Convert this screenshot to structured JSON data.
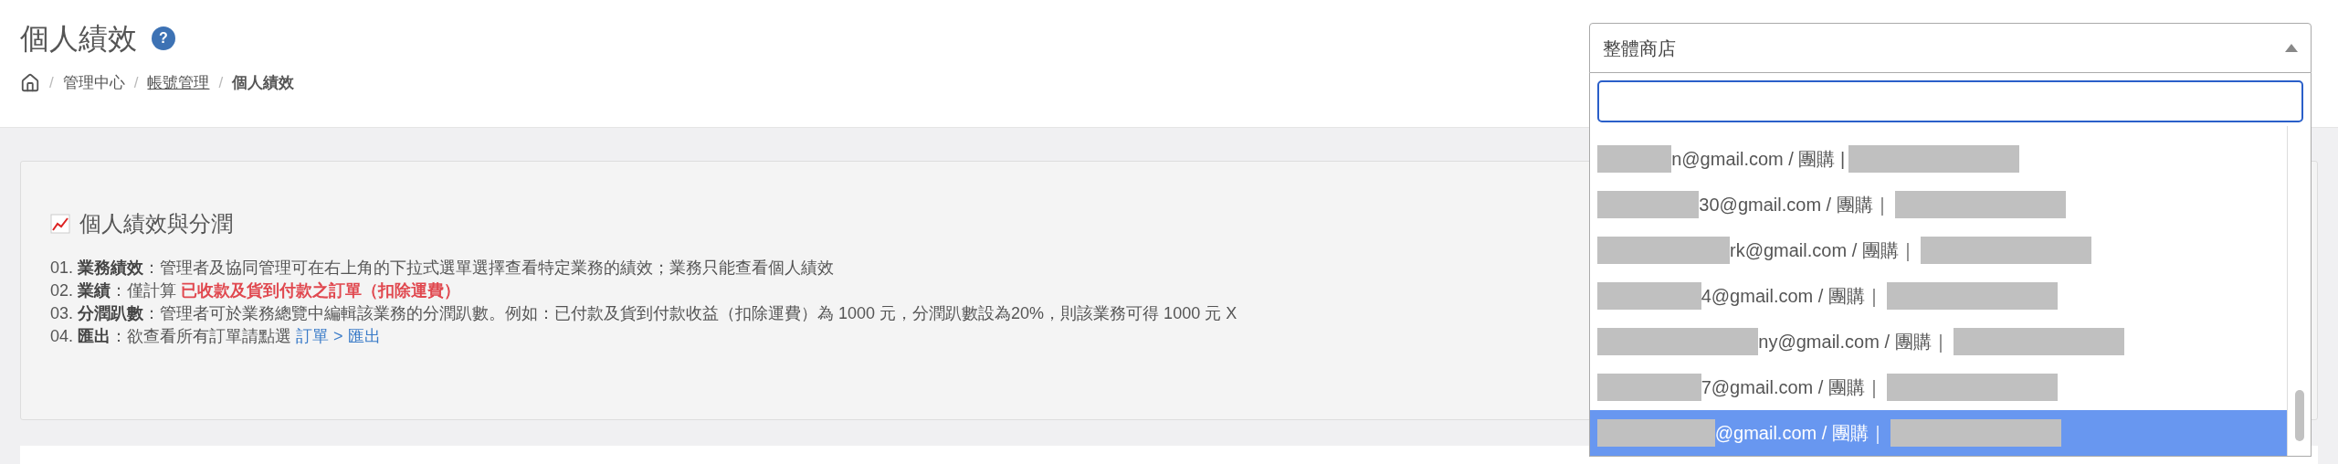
{
  "page": {
    "title": "個人績效",
    "help_mark": "?",
    "breadcrumb": [
      {
        "separator": "/",
        "label": "管理中心",
        "kind": "text"
      },
      {
        "separator": "/",
        "label": "帳號管理",
        "kind": "link"
      },
      {
        "separator": "/",
        "label": "個人績效",
        "kind": "current"
      }
    ]
  },
  "info_card": {
    "title": "個人績效與分潤",
    "items": [
      {
        "number": "01.",
        "parts": [
          {
            "kind": "term",
            "text": "業務績效"
          },
          {
            "kind": "text",
            "text": "：管理者及協同管理可在右上角的下拉式選單選擇查看特定業務的績效；業務只能查看個人績效"
          }
        ]
      },
      {
        "number": "02.",
        "parts": [
          {
            "kind": "term",
            "text": "業績"
          },
          {
            "kind": "text",
            "text": "：僅計算 "
          },
          {
            "kind": "highlight",
            "text": "已收款及貨到付款之訂單（扣除運費）"
          }
        ]
      },
      {
        "number": "03.",
        "parts": [
          {
            "kind": "term",
            "text": "分潤趴數"
          },
          {
            "kind": "text",
            "text": "：管理者可於業務總覽中編輯該業務的分潤趴數。例如：已付款及貨到付款收益（扣除運費）為 1000 元，分潤趴數設為20%，則該業務可得 1000 元 X"
          }
        ]
      },
      {
        "number": "04.",
        "parts": [
          {
            "kind": "term",
            "text": "匯出"
          },
          {
            "kind": "text",
            "text": "：欲查看所有訂單請點選 "
          },
          {
            "kind": "link",
            "text": "訂單 > 匯出"
          }
        ]
      }
    ]
  },
  "store_select": {
    "value": "整體商店",
    "expanded": true,
    "options": [
      {
        "text": "n@gmail.com / 團購 |",
        "selected": false
      },
      {
        "text": "30@gmail.com / 團購｜",
        "selected": false
      },
      {
        "text": "rk@gmail.com / 團購｜",
        "selected": false
      },
      {
        "text": "4@gmail.com / 團購｜",
        "selected": false
      },
      {
        "text": "ny@gmail.com / 團購｜",
        "selected": false
      },
      {
        "text": "7@gmail.com / 團購｜",
        "selected": false
      },
      {
        "text": "@gmail.com / 團購｜",
        "selected": true
      }
    ]
  }
}
